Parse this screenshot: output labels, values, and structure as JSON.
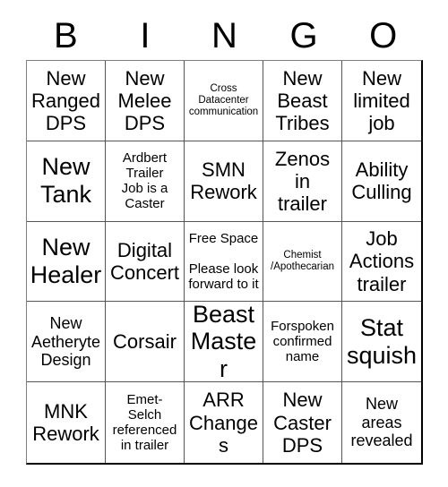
{
  "card": {
    "header_letters": [
      "B",
      "I",
      "N",
      "G",
      "O"
    ],
    "rows": 5,
    "columns": 5,
    "colors": {
      "background": "#ffffff",
      "text": "#000000",
      "grid_line": "#555555",
      "outer_border": "#000000"
    },
    "cells": [
      {
        "text": "New\nRanged\nDPS",
        "size": "lg"
      },
      {
        "text": "New\nMelee\nDPS",
        "size": "lg"
      },
      {
        "text": "Cross\nDatacenter\ncommunication",
        "size": "xs"
      },
      {
        "text": "New\nBeast\nTribes",
        "size": "lg"
      },
      {
        "text": "New\nlimited\njob",
        "size": "lg"
      },
      {
        "text": "New\nTank",
        "size": "xl"
      },
      {
        "text": "Ardbert\nTrailer\nJob is a\nCaster",
        "size": "sm"
      },
      {
        "text": "SMN\nRework",
        "size": "lg"
      },
      {
        "text": "Zenos\nin\ntrailer",
        "size": "lg"
      },
      {
        "text": "Ability\nCulling",
        "size": "lg"
      },
      {
        "text": "New\nHealer",
        "size": "xl"
      },
      {
        "text": "Digital\nConcert",
        "size": "lg"
      },
      {
        "text": "Free Space\n\nPlease look\nforward to it",
        "size": "sm"
      },
      {
        "text": "Chemist\n/Apothecarian",
        "size": "xs"
      },
      {
        "text": "Job\nActions\ntrailer",
        "size": "lg"
      },
      {
        "text": "New\nAetheryte\nDesign",
        "size": "md"
      },
      {
        "text": "Corsair",
        "size": "lg"
      },
      {
        "text": "Beast\nMaster",
        "size": "xl"
      },
      {
        "text": "Forspoken\nconfirmed\nname",
        "size": "sm"
      },
      {
        "text": "Stat\nsquish",
        "size": "xl"
      },
      {
        "text": "MNK\nRework",
        "size": "lg"
      },
      {
        "text": "Emet-\nSelch\nreferenced\nin trailer",
        "size": "sm"
      },
      {
        "text": "ARR\nChanges",
        "size": "lg"
      },
      {
        "text": "New\nCaster\nDPS",
        "size": "lg"
      },
      {
        "text": "New\nareas\nrevealed",
        "size": "md"
      }
    ]
  }
}
